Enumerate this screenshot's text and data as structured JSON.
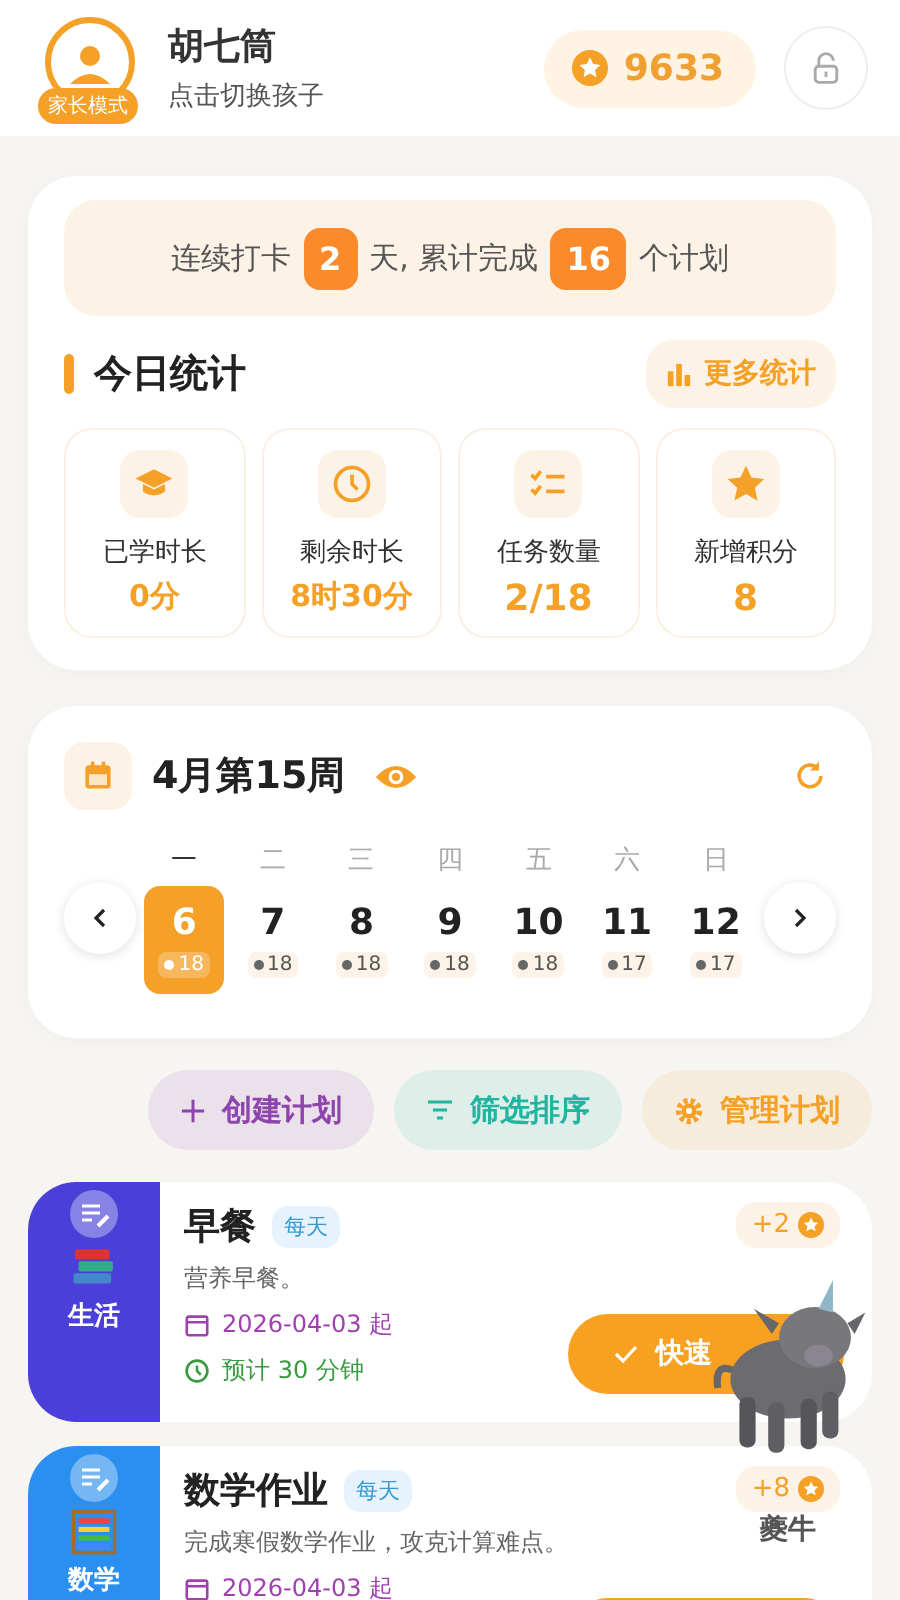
{
  "header": {
    "mode_badge": "家长模式",
    "name": "胡七筒",
    "subtitle": "点击切换孩子",
    "points": "9633"
  },
  "streak": {
    "text_before": "连续打卡",
    "days": "2",
    "text_middle": "天, 累计完成",
    "count": "16",
    "text_after": "个计划"
  },
  "stats": {
    "title": "今日统计",
    "more_button": "更多统计",
    "items": [
      {
        "kind": "study",
        "label": "已学时长",
        "value": "0分"
      },
      {
        "kind": "clock",
        "label": "剩余时长",
        "value": "8时30分"
      },
      {
        "kind": "tasks",
        "label": "任务数量",
        "value": "2/18"
      },
      {
        "kind": "star",
        "label": "新增积分",
        "value": "8"
      }
    ]
  },
  "week": {
    "title": "4月第15周",
    "days": [
      {
        "weekday": "一",
        "date": "6",
        "count": "18",
        "selected": true
      },
      {
        "weekday": "二",
        "date": "7",
        "count": "18",
        "selected": false
      },
      {
        "weekday": "三",
        "date": "8",
        "count": "18",
        "selected": false
      },
      {
        "weekday": "四",
        "date": "9",
        "count": "18",
        "selected": false
      },
      {
        "weekday": "五",
        "date": "10",
        "count": "18",
        "selected": false
      },
      {
        "weekday": "六",
        "date": "11",
        "count": "17",
        "selected": false
      },
      {
        "weekday": "日",
        "date": "12",
        "count": "17",
        "selected": false
      }
    ]
  },
  "actions": [
    {
      "kind": "create",
      "label": "创建计划",
      "color": "#8e44ad"
    },
    {
      "kind": "filter",
      "label": "筛选排序",
      "color": "#1fb5a0"
    },
    {
      "kind": "manage",
      "label": "管理计划",
      "color": "#f5a027"
    }
  ],
  "plans": [
    {
      "kind": "books",
      "category": "生活",
      "color": "#4a3fd8",
      "title": "早餐",
      "frequency": "每天",
      "description": "营养早餐。",
      "start": "2026-04-03 起",
      "duration": "预计 30 分钟",
      "points": "+2",
      "action": "快速"
    },
    {
      "kind": "abacus",
      "category": "数学",
      "color": "#2b8ff0",
      "title": "数学作业",
      "frequency": "每天",
      "description": "完成寒假数学作业，攻克计算难点。",
      "start": "2026-04-03 起",
      "points": "+8"
    }
  ],
  "pet": {
    "name": "夔牛"
  }
}
